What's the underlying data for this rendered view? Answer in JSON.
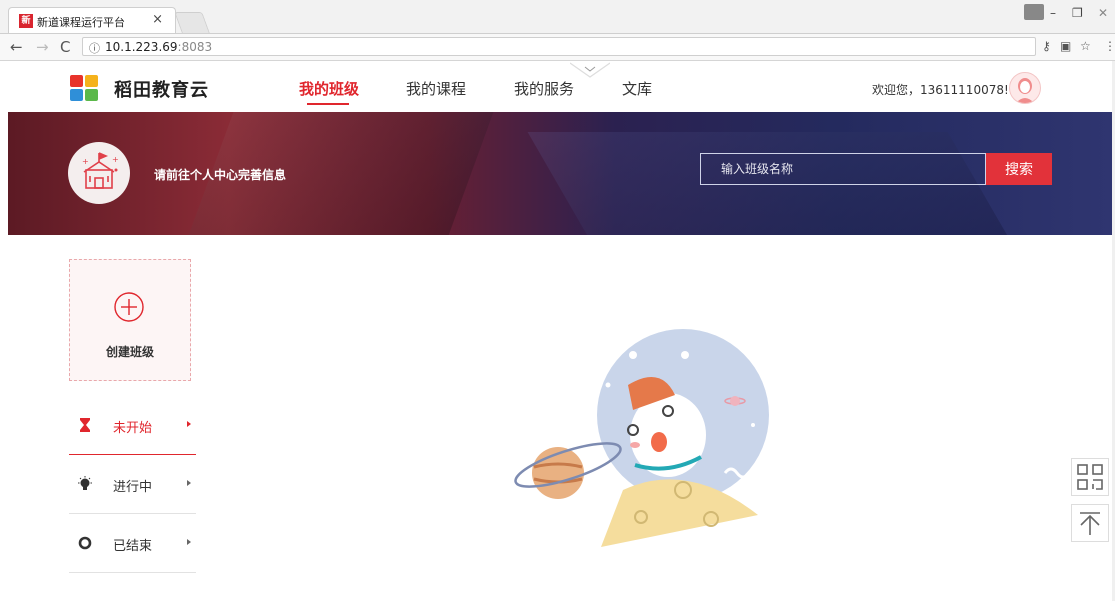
{
  "browser": {
    "tab_title": "新道课程运行平台",
    "tab_close": "×",
    "url_host": "10.1.223.69",
    "url_port": ":8083",
    "icons": [
      "back-icon",
      "forward-icon",
      "reload-icon",
      "info-icon",
      "key-icon",
      "translate-icon",
      "star-icon",
      "menu-icon"
    ]
  },
  "header": {
    "brand": "稻田教育云",
    "nav": [
      {
        "label": "我的班级",
        "active": true
      },
      {
        "label": "我的课程",
        "active": false
      },
      {
        "label": "我的服务",
        "active": false
      },
      {
        "label": "文库",
        "active": false
      }
    ],
    "welcome": "欢迎您，13611110078!"
  },
  "banner": {
    "tip": "请前往个人中心完善信息",
    "search_placeholder": "输入班级名称",
    "search_button": "搜索"
  },
  "sidebar": {
    "create_label": "创建班级",
    "statuses": [
      {
        "label": "未开始",
        "icon": "hourglass-icon",
        "active": true
      },
      {
        "label": "进行中",
        "icon": "lightbulb-icon",
        "active": false
      },
      {
        "label": "已结束",
        "icon": "stop-circle-icon",
        "active": false
      }
    ]
  },
  "colors": {
    "accent": "#e0262d",
    "banner_left": "#7a2530",
    "banner_right": "#262c60"
  }
}
